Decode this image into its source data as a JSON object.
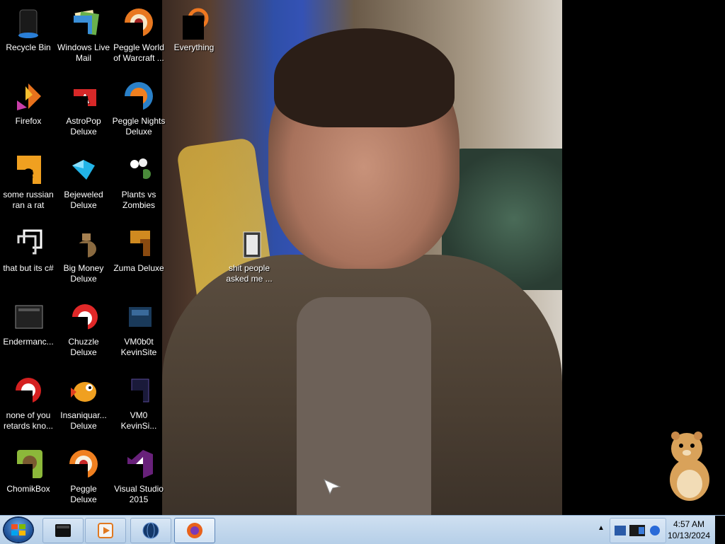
{
  "desktop": {
    "icons": [
      {
        "label": "Recycle Bin"
      },
      {
        "label": "Windows Live Mail"
      },
      {
        "label": "Peggle World of Warcraft ..."
      },
      {
        "label": "Everything"
      },
      {
        "label": "Firefox"
      },
      {
        "label": "AstroPop Deluxe"
      },
      {
        "label": "Peggle Nights Deluxe"
      },
      {
        "label": "some russian ran a rat"
      },
      {
        "label": "Bejeweled Deluxe"
      },
      {
        "label": "Plants vs Zombies"
      },
      {
        "label": "that but its c#"
      },
      {
        "label": "Big Money Deluxe"
      },
      {
        "label": "Zuma Deluxe"
      },
      {
        "label": "shit people asked me ..."
      },
      {
        "label": "Endermanc..."
      },
      {
        "label": "Chuzzle Deluxe"
      },
      {
        "label": "VM0b0t KevinSite"
      },
      {
        "label": "none of you retards kno..."
      },
      {
        "label": "Insaniquar... Deluxe"
      },
      {
        "label": "VM0 KevinSi..."
      },
      {
        "label": "ChomikBox"
      },
      {
        "label": "Peggle Deluxe"
      },
      {
        "label": "Visual Studio 2015"
      }
    ]
  },
  "taskbar": {
    "start_label": "Start",
    "pinned": [
      {
        "name": "terminal-icon"
      },
      {
        "name": "media-player-icon"
      },
      {
        "name": "globe-icon"
      },
      {
        "name": "firefox-icon"
      }
    ],
    "tray_arrow": "▲",
    "clock_time": "4:57 AM",
    "clock_date": "10/13/2024"
  }
}
